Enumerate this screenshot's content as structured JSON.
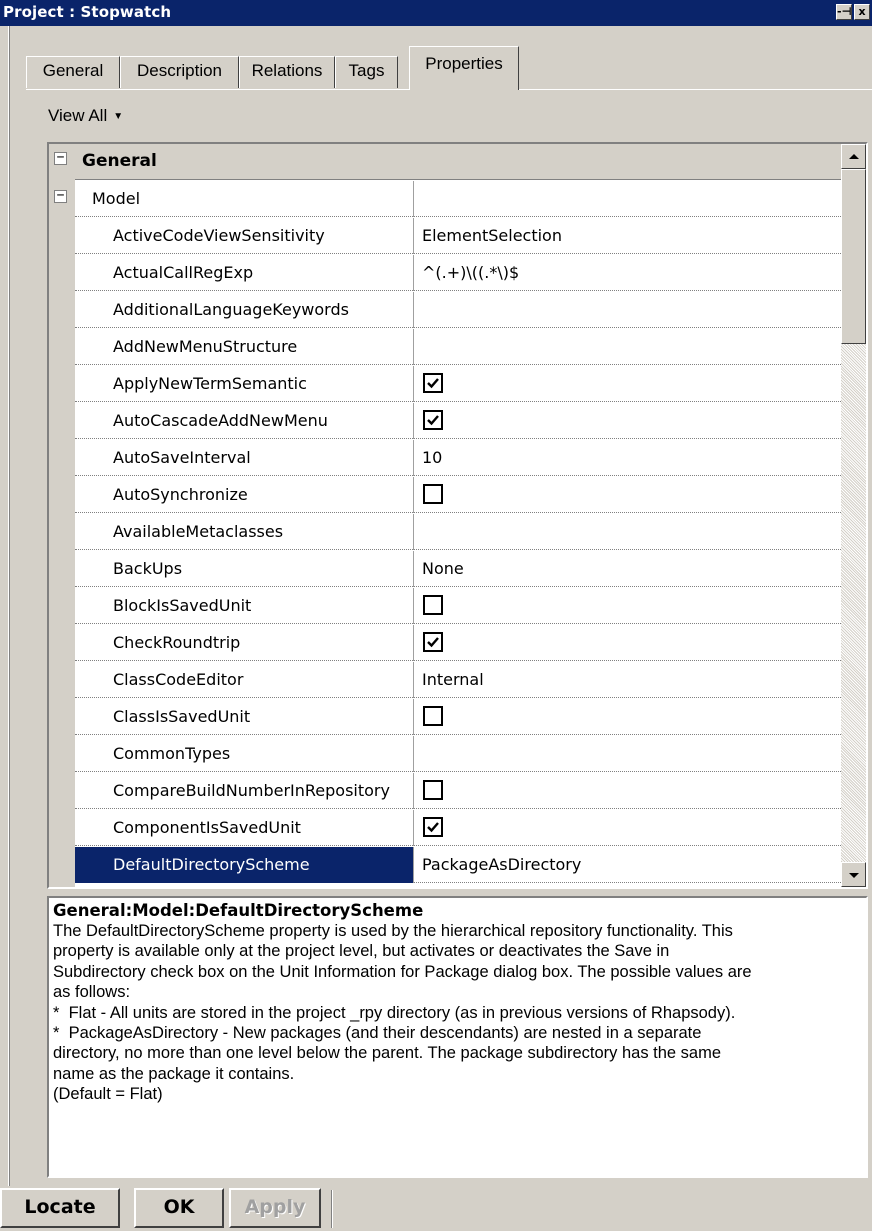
{
  "window": {
    "title": "Project : Stopwatch",
    "pin_glyph": "-⊣",
    "close_glyph": "x"
  },
  "tabs": [
    {
      "label": "General"
    },
    {
      "label": "Description"
    },
    {
      "label": "Relations"
    },
    {
      "label": "Tags"
    },
    {
      "label": "Properties",
      "active": true
    }
  ],
  "view_filter": {
    "label": "View All"
  },
  "grid": {
    "section": {
      "label": "General",
      "expander": "−"
    },
    "group": {
      "label": "Model",
      "expander": "−"
    },
    "rows": [
      {
        "name": "ActiveCodeViewSensitivity",
        "value": "ElementSelection"
      },
      {
        "name": "ActualCallRegExp",
        "value": "^(.+)\\((.*\\)$"
      },
      {
        "name": "AdditionalLanguageKeywords",
        "value": ""
      },
      {
        "name": "AddNewMenuStructure",
        "value": ""
      },
      {
        "name": "ApplyNewTermSemantic",
        "checkbox": true,
        "checked": true
      },
      {
        "name": "AutoCascadeAddNewMenu",
        "checkbox": true,
        "checked": true
      },
      {
        "name": "AutoSaveInterval",
        "value": "10"
      },
      {
        "name": "AutoSynchronize",
        "checkbox": true,
        "checked": false
      },
      {
        "name": "AvailableMetaclasses",
        "value": ""
      },
      {
        "name": "BackUps",
        "value": "None"
      },
      {
        "name": "BlockIsSavedUnit",
        "checkbox": true,
        "checked": false
      },
      {
        "name": "CheckRoundtrip",
        "checkbox": true,
        "checked": true
      },
      {
        "name": "ClassCodeEditor",
        "value": "Internal"
      },
      {
        "name": "ClassIsSavedUnit",
        "checkbox": true,
        "checked": false
      },
      {
        "name": "CommonTypes",
        "value": ""
      },
      {
        "name": "CompareBuildNumberInRepository",
        "checkbox": true,
        "checked": false
      },
      {
        "name": "ComponentIsSavedUnit",
        "checkbox": true,
        "checked": true
      },
      {
        "name": "DefaultDirectoryScheme",
        "value": "PackageAsDirectory",
        "selected": true
      }
    ]
  },
  "description": {
    "title": "General:Model:DefaultDirectoryScheme",
    "lines": [
      "The DefaultDirectoryScheme property is used by the hierarchical repository functionality. This",
      "property is available only at the project level, but activates or deactivates the Save in",
      "Subdirectory check box on the Unit Information for Package dialog box. The possible values are",
      "as follows:",
      "*  Flat - All units are stored in the project _rpy directory (as in previous versions of Rhapsody).",
      "*  PackageAsDirectory - New packages (and their descendants) are nested in a separate",
      "directory, no more than one level below the parent. The package subdirectory has the same",
      "name as the package it contains.",
      "(Default = Flat)"
    ]
  },
  "buttons": {
    "locate": "Locate",
    "ok": "OK",
    "apply": "Apply"
  },
  "colors": {
    "titlebar": "#0a246a",
    "selection": "#0a246a",
    "face": "#d4d0c8"
  }
}
